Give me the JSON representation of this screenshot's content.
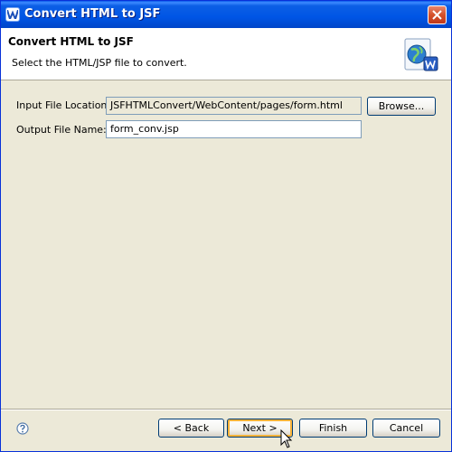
{
  "window": {
    "title": "Convert HTML to JSF"
  },
  "header": {
    "title": "Convert HTML to JSF",
    "description": "Select the HTML/JSP file to convert."
  },
  "form": {
    "input_label": "Input File Location:",
    "input_value": "JSFHTMLConvert/WebContent/pages/form.html",
    "browse_label": "Browse...",
    "output_label": "Output File Name:",
    "output_value": "form_conv.jsp"
  },
  "buttons": {
    "back": "< Back",
    "next": "Next >",
    "finish": "Finish",
    "cancel": "Cancel"
  },
  "icons": {
    "app": "app-w-icon",
    "close": "close-icon",
    "wizard": "globe-document-icon",
    "help": "help-icon",
    "cursor": "mouse-pointer-icon"
  },
  "colors": {
    "titlebar": "#0055E5",
    "dialog_bg": "#ECE9D8",
    "focus_border": "#F8B33A"
  }
}
